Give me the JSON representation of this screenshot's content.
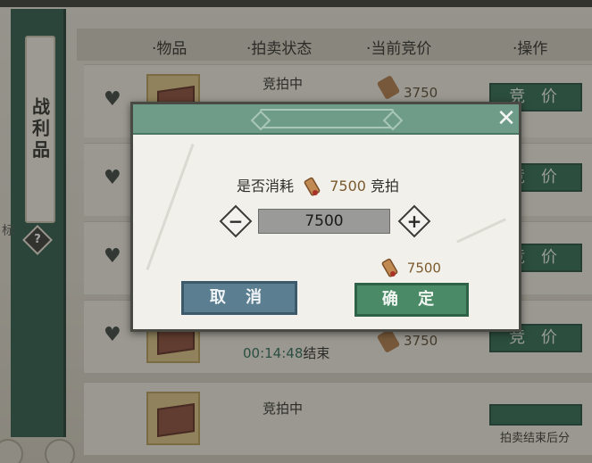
{
  "side_tab": {
    "label": "战利品",
    "help": "?"
  },
  "left_edge_char": "标",
  "table": {
    "headers": [
      "·物品",
      "·拍卖状态",
      "·当前竞价",
      "·操作"
    ],
    "rows": [
      {
        "status": "竞拍中",
        "timer": "",
        "timer_suffix": "",
        "price": "3750",
        "action": "竞 价"
      },
      {
        "status": "",
        "timer": "",
        "timer_suffix": "",
        "price": "",
        "action": "竞 价"
      },
      {
        "status": "",
        "timer": "",
        "timer_suffix": "",
        "price": "",
        "action": "竞 价"
      },
      {
        "status": "",
        "timer": "00:14:48",
        "timer_suffix": "结束",
        "price": "3750",
        "action": "竞 价"
      },
      {
        "status": "竞拍中",
        "timer": "",
        "timer_suffix": "",
        "price": "",
        "action": ""
      }
    ]
  },
  "footer_note": "拍卖结束后分",
  "dialog": {
    "prompt_prefix": "是否消耗",
    "prompt_amount": "7500",
    "prompt_suffix": "竞拍",
    "minus": "−",
    "plus": "+",
    "bid_value": "7500",
    "balance": "7500",
    "cancel": "取 消",
    "confirm": "确 定",
    "close": "✕"
  },
  "colors": {
    "header_green": "#6f9c88",
    "confirm_green": "#4b8a66",
    "cancel_blue": "#5b7f91",
    "bid_button_green": "#2f6a52"
  }
}
